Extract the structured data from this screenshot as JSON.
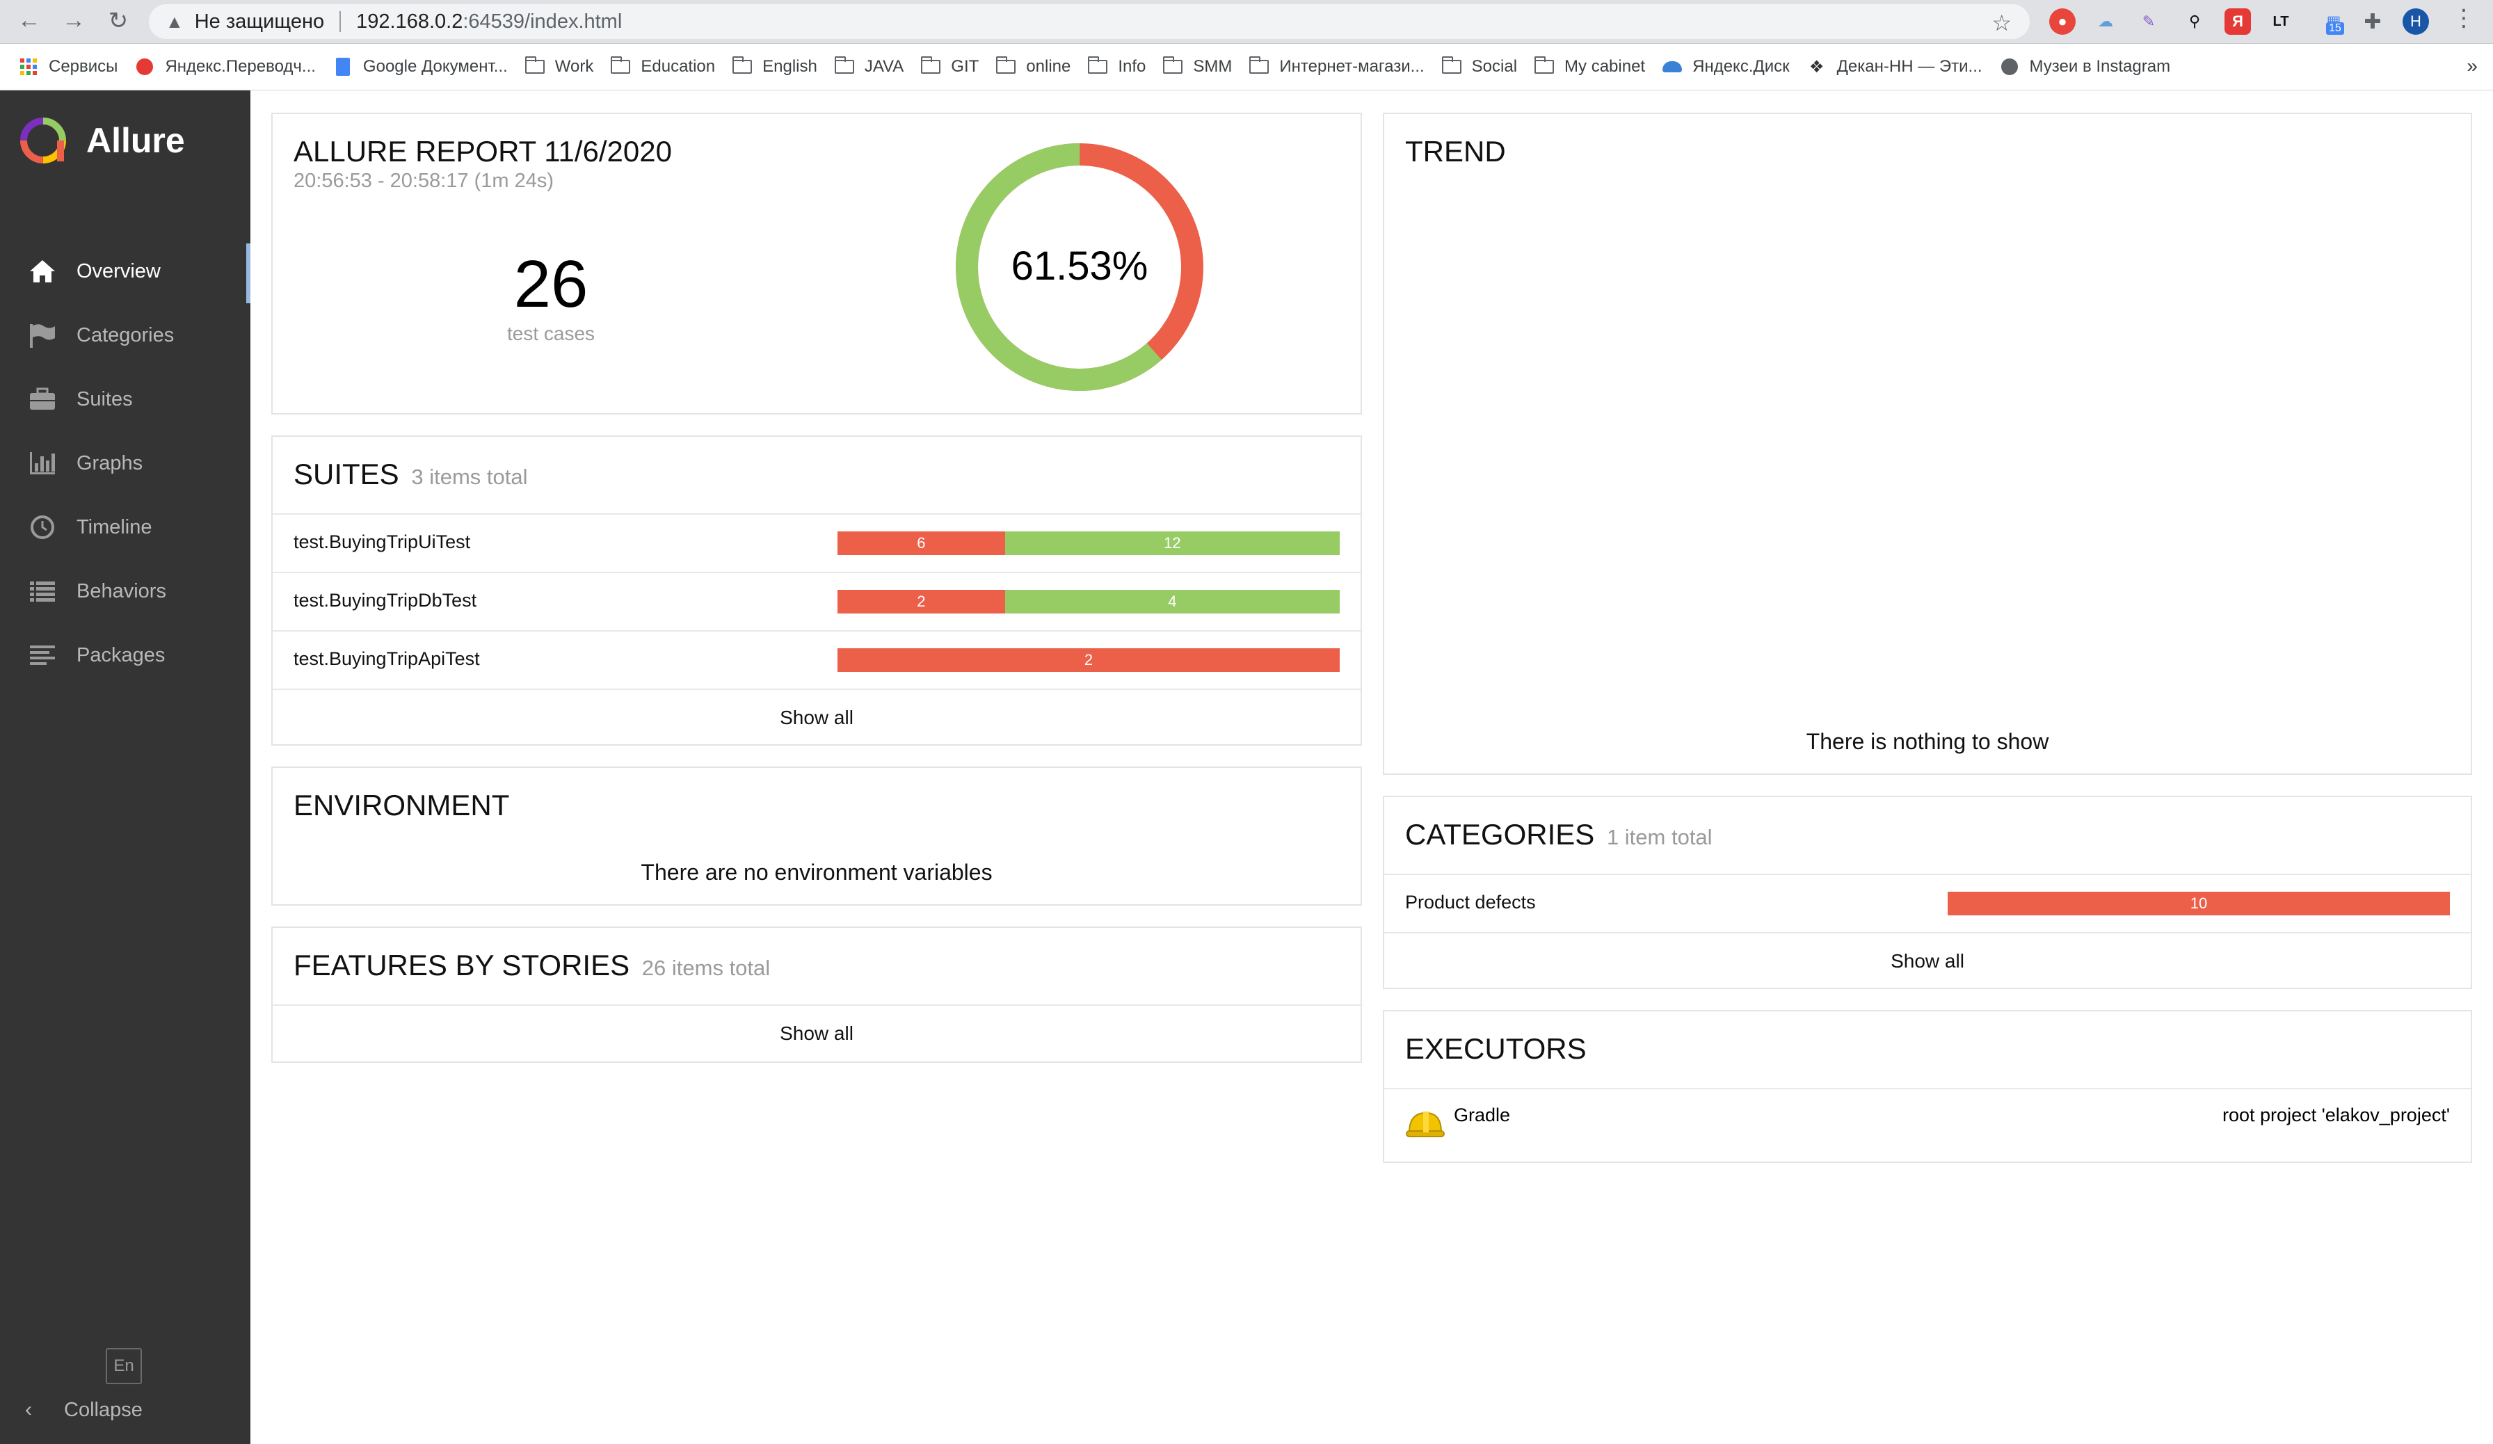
{
  "browser": {
    "security_label": "Не защищено",
    "url_host": "192.168.0.2",
    "url_path": ":64539/index.html",
    "profile_initial": "H",
    "ext_badge": "15",
    "bookmarks": [
      {
        "label": "Сервисы",
        "icon": "apps-grid-icon"
      },
      {
        "label": "Яндекс.Переводч...",
        "icon": "yandex-translate-icon"
      },
      {
        "label": "Google Документ...",
        "icon": "google-docs-icon"
      },
      {
        "label": "Work",
        "icon": "folder-icon"
      },
      {
        "label": "Education",
        "icon": "folder-icon"
      },
      {
        "label": "English",
        "icon": "folder-icon"
      },
      {
        "label": "JAVA",
        "icon": "folder-icon"
      },
      {
        "label": "GIT",
        "icon": "folder-icon"
      },
      {
        "label": "online",
        "icon": "folder-icon"
      },
      {
        "label": "Info",
        "icon": "folder-icon"
      },
      {
        "label": "SMM",
        "icon": "folder-icon"
      },
      {
        "label": "Интернет-магази...",
        "icon": "folder-icon"
      },
      {
        "label": "Social",
        "icon": "folder-icon"
      },
      {
        "label": "My cabinet",
        "icon": "folder-icon"
      },
      {
        "label": "Яндекс.Диск",
        "icon": "yandex-disk-icon"
      },
      {
        "label": "Декан-НН — Эти...",
        "icon": "dekan-icon"
      },
      {
        "label": "Музеи в Instagram",
        "icon": "globe-icon"
      }
    ],
    "more_label": "»"
  },
  "sidebar": {
    "app_name": "Allure",
    "items": [
      {
        "label": "Overview",
        "icon": "home-icon",
        "active": true
      },
      {
        "label": "Categories",
        "icon": "flag-icon"
      },
      {
        "label": "Suites",
        "icon": "briefcase-icon"
      },
      {
        "label": "Graphs",
        "icon": "bar-chart-icon"
      },
      {
        "label": "Timeline",
        "icon": "clock-icon"
      },
      {
        "label": "Behaviors",
        "icon": "list-icon"
      },
      {
        "label": "Packages",
        "icon": "align-left-icon"
      }
    ],
    "language": "En",
    "collapse_label": "Collapse"
  },
  "summary": {
    "title": "ALLURE REPORT 11/6/2020",
    "time_range": "20:56:53 - 20:58:17 (1m 24s)",
    "test_count": "26",
    "test_count_label": "test cases",
    "success_rate": "61.53%",
    "success_fraction": 0.6153,
    "colors": {
      "passed": "#97cc64",
      "failed": "#ec5f49"
    }
  },
  "suites": {
    "title": "SUITES",
    "subtitle": "3 items total",
    "rows": [
      {
        "name": "test.BuyingTripUiTest",
        "failed": 6,
        "passed": 12
      },
      {
        "name": "test.BuyingTripDbTest",
        "failed": 2,
        "passed": 4
      },
      {
        "name": "test.BuyingTripApiTest",
        "failed": 2,
        "passed": 0
      }
    ],
    "show_all": "Show all"
  },
  "environment": {
    "title": "ENVIRONMENT",
    "message": "There are no environment variables"
  },
  "features": {
    "title": "FEATURES BY STORIES",
    "subtitle": "26 items total",
    "show_all": "Show all"
  },
  "trend": {
    "title": "TREND",
    "message": "There is nothing to show"
  },
  "categories": {
    "title": "CATEGORIES",
    "subtitle": "1 item total",
    "rows": [
      {
        "name": "Product defects",
        "failed": 10
      }
    ],
    "show_all": "Show all"
  },
  "executors": {
    "title": "EXECUTORS",
    "name": "Gradle",
    "detail": "root project 'elakov_project'"
  }
}
